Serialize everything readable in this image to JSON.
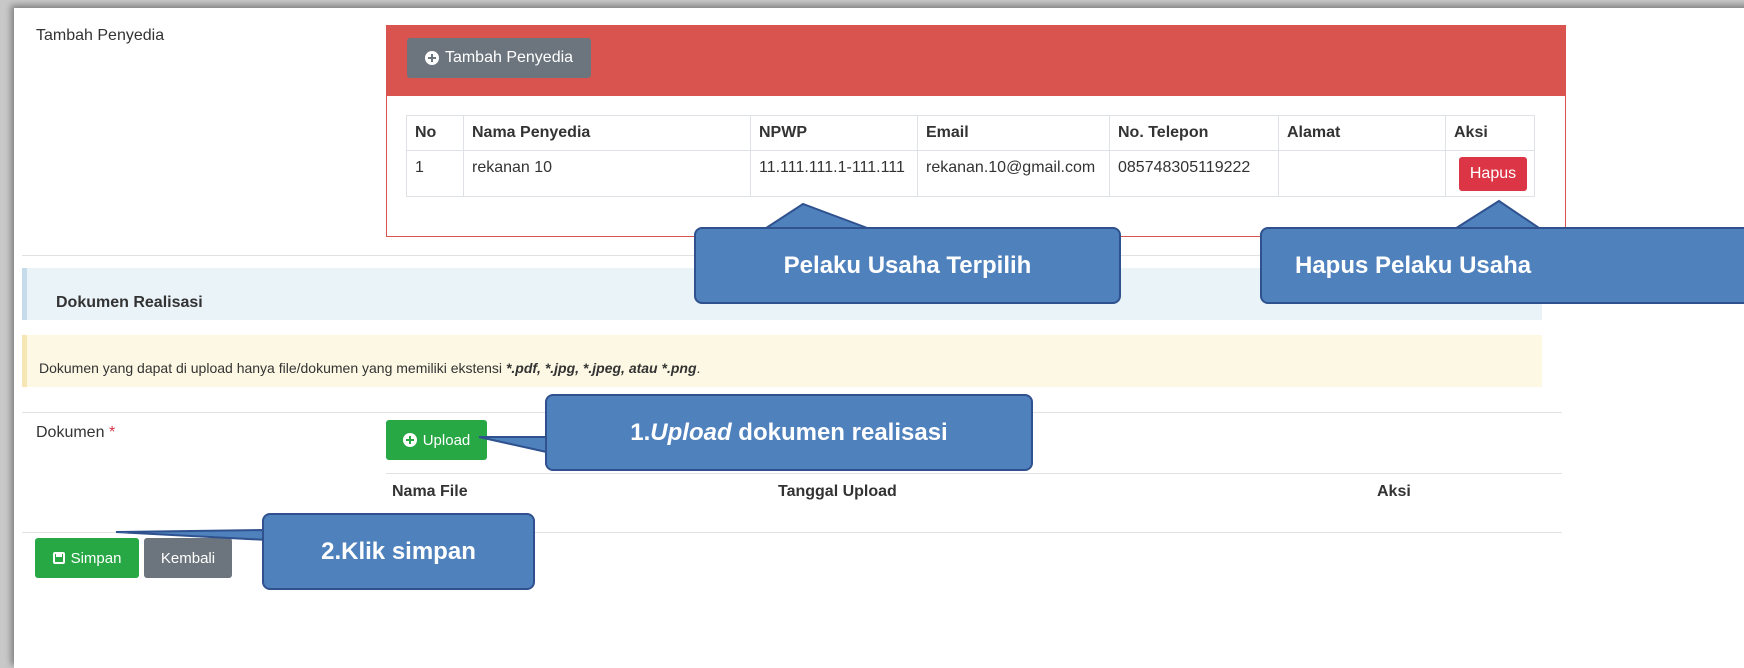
{
  "provider_section": {
    "label": "Tambah Penyedia",
    "add_button": "Tambah Penyedia",
    "table": {
      "headers": [
        "No",
        "Nama Penyedia",
        "NPWP",
        "Email",
        "No. Telepon",
        "Alamat",
        "Aksi"
      ],
      "rows": [
        [
          "1",
          "rekanan 10",
          "11.111.111.1-111.111",
          "rekanan.10@gmail.com",
          "085748305119222",
          "",
          "Hapus"
        ]
      ]
    }
  },
  "realization": {
    "section_title": "Dokumen Realisasi",
    "notice_prefix": "Dokumen yang dapat di upload hanya file/dokumen yang memiliki ekstensi ",
    "notice_extensions": "*.pdf, *.jpg, *.jpeg, atau *.png",
    "notice_suffix": ".",
    "document_label": "Dokumen",
    "required_mark": "*",
    "upload_button": "Upload",
    "file_table_headers": [
      "Nama File",
      "Tanggal Upload",
      "Aksi"
    ]
  },
  "footer": {
    "save_button": "Simpan",
    "back_button": "Kembali"
  },
  "callouts": {
    "selected": "Pelaku Usaha Terpilih",
    "delete": "Hapus Pelaku Usaha",
    "step1_prefix": "1.",
    "step1_italic": "Upload",
    "step1_suffix": " dokumen realisasi",
    "step2": "2.Klik simpan"
  },
  "colors": {
    "panel_danger": "#d9534f",
    "button_gray": "#6c757d",
    "button_green": "#28a745",
    "button_red": "#dc3545",
    "callout_fill": "#4f81bd",
    "callout_border": "#2f528f"
  },
  "icons": [
    "plus-circle-icon",
    "save-icon"
  ]
}
